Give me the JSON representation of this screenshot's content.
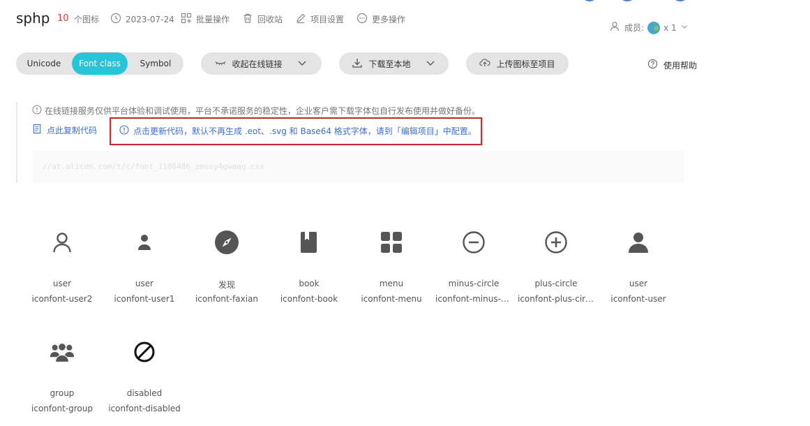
{
  "header": {
    "project_name": "sphp",
    "icon_count": "10",
    "icon_count_label": "个图标",
    "date": "2023-07-24",
    "batch_ops": "批量操作",
    "recycle_bin": "回收站",
    "project_settings": "项目设置",
    "more_ops": "更多操作",
    "members_label": "成员:",
    "members_count": "x 1"
  },
  "toolbar": {
    "tabs": [
      {
        "label": "Unicode",
        "active": false
      },
      {
        "label": "Font class",
        "active": true
      },
      {
        "label": "Symbol",
        "active": false
      }
    ],
    "collapse_link": "收起在线链接",
    "download": "下载至本地",
    "upload": "上传图标至项目",
    "help": "使用帮助"
  },
  "info": {
    "notice": "在线链接服务仅供平台体验和调试使用，平台不承诺服务的稳定性，企业客户需下载字体包自行发布使用并做好备份。",
    "copy_code": "点此复制代码",
    "update_code": "点击更新代码，默认不再生成 .eot、.svg 和 Base64 格式字体，请到「编辑项目」中配置。",
    "css_url": "//at.alicdn.com/t/c/font_1186486_zmusy4gwaqq.css"
  },
  "icons": [
    {
      "icon": "user-outline-icon",
      "name": "user",
      "code": "iconfont-user2"
    },
    {
      "icon": "user-small-icon",
      "name": "user",
      "code": "iconfont-user1"
    },
    {
      "icon": "compass-icon",
      "name": "发现",
      "code": "iconfont-faxian"
    },
    {
      "icon": "book-icon",
      "name": "book",
      "code": "iconfont-book"
    },
    {
      "icon": "menu-grid-icon",
      "name": "menu",
      "code": "iconfont-menu"
    },
    {
      "icon": "minus-circle-icon",
      "name": "minus-circle",
      "code": "iconfont-minus-c..."
    },
    {
      "icon": "plus-circle-icon",
      "name": "plus-circle",
      "code": "iconfont-plus-circle"
    },
    {
      "icon": "user-filled-icon",
      "name": "user",
      "code": "iconfont-user"
    },
    {
      "icon": "group-icon",
      "name": "group",
      "code": "iconfont-group"
    },
    {
      "icon": "disabled-icon",
      "name": "disabled",
      "code": "iconfont-disabled"
    }
  ],
  "colors": {
    "accent": "#26c6da",
    "count_red": "#e53935",
    "link_blue": "#3c6fd8",
    "highlight_border": "#e02020",
    "icon_gray": "#555555"
  }
}
